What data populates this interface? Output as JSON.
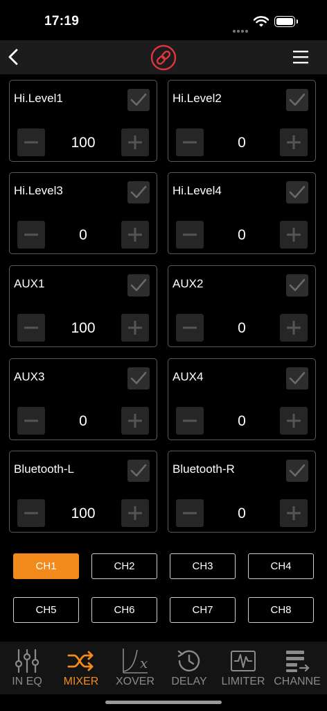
{
  "status_bar": {
    "time": "17:19"
  },
  "nav": {
    "back": "back-icon",
    "center": "link-icon",
    "menu": "menu-icon"
  },
  "channels": [
    {
      "label": "Hi.Level1",
      "value": "100",
      "checked": true
    },
    {
      "label": "Hi.Level2",
      "value": "0",
      "checked": true
    },
    {
      "label": "Hi.Level3",
      "value": "0",
      "checked": true
    },
    {
      "label": "Hi.Level4",
      "value": "0",
      "checked": true
    },
    {
      "label": "AUX1",
      "value": "100",
      "checked": true
    },
    {
      "label": "AUX2",
      "value": "0",
      "checked": true
    },
    {
      "label": "AUX3",
      "value": "0",
      "checked": true
    },
    {
      "label": "AUX4",
      "value": "0",
      "checked": true
    },
    {
      "label": "Bluetooth-L",
      "value": "100",
      "checked": true
    },
    {
      "label": "Bluetooth-R",
      "value": "0",
      "checked": true
    }
  ],
  "output_channels": [
    "CH1",
    "CH2",
    "CH3",
    "CH4",
    "CH5",
    "CH6",
    "CH7",
    "CH8"
  ],
  "selected_output_channel": "CH1",
  "tabs": [
    {
      "label": "IN EQ",
      "icon": "sliders-icon"
    },
    {
      "label": "MIXER",
      "icon": "shuffle-icon"
    },
    {
      "label": "XOVER",
      "icon": "crossover-icon"
    },
    {
      "label": "DELAY",
      "icon": "clock-icon"
    },
    {
      "label": "LIMITER",
      "icon": "waveform-icon"
    },
    {
      "label": "CHANNE",
      "icon": "channel-icon"
    }
  ],
  "active_tab": "MIXER",
  "colors": {
    "accent": "#f28a1c",
    "link_icon": "#e0353c",
    "nav_bg": "#1c1c1c",
    "tab_bg": "#141414"
  }
}
